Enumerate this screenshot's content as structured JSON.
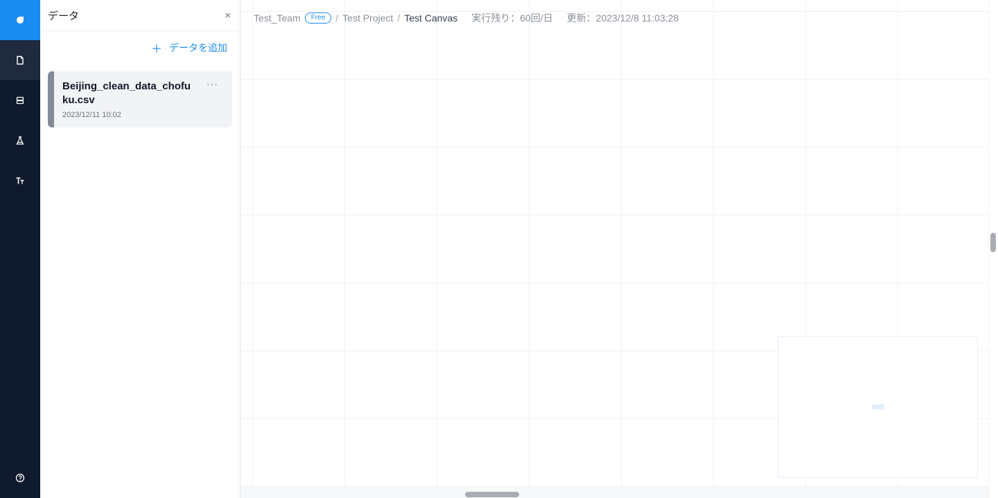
{
  "rail": {
    "items": [
      {
        "name": "data-files",
        "icon": "file-icon",
        "active": true
      },
      {
        "name": "database",
        "icon": "database-icon",
        "active": false
      },
      {
        "name": "model",
        "icon": "flask-icon",
        "active": false
      },
      {
        "name": "text",
        "icon": "text-size-icon",
        "active": false
      }
    ],
    "help_icon": "help-circle-icon"
  },
  "panel": {
    "title": "データ",
    "close_label": "×",
    "add_plus": "＋",
    "add_label": "データを追加",
    "files": [
      {
        "name": "Beijing_clean_data_chofuku.csv",
        "date": "2023/12/11 10:02",
        "more": "···"
      }
    ]
  },
  "breadcrumb": {
    "team": "Test_Team",
    "plan": "Free",
    "separator": "/",
    "project": "Test Project",
    "canvas": "Test Canvas",
    "runs_remaining": "実行残り：60回/日",
    "updated": "更新：2023/12/8 11:03:28"
  },
  "colors": {
    "accent": "#1a8cf0",
    "rail_bg": "#101a2e",
    "card_bar": "#838b96"
  }
}
